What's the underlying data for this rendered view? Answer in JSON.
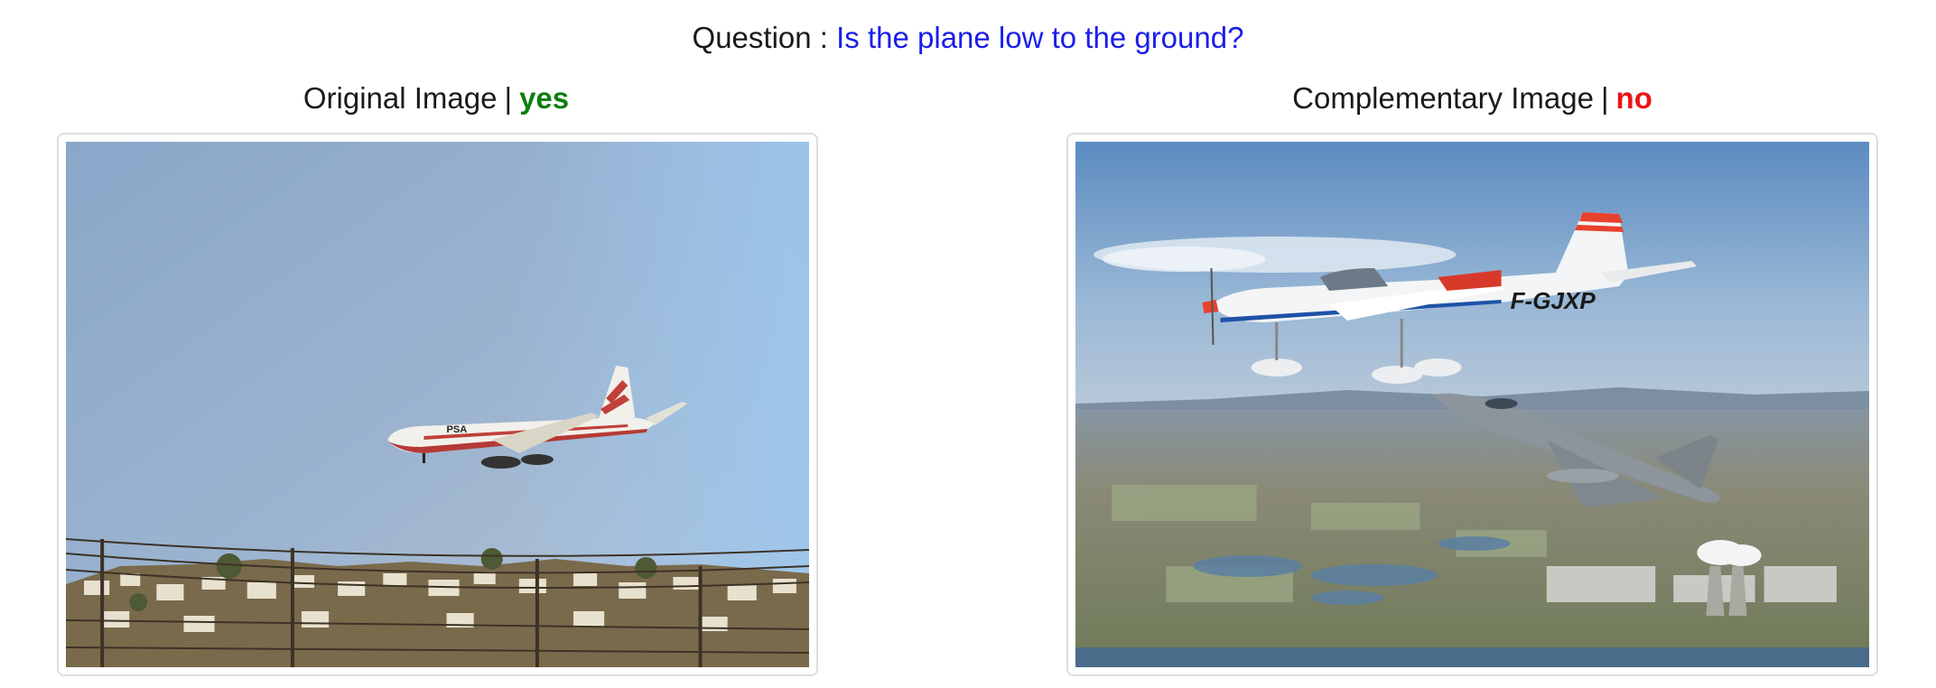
{
  "question": {
    "prefix": "Question :",
    "text": "Is the plane low to the ground?"
  },
  "original": {
    "title": "Original Image",
    "separator": "|",
    "answer": "yes",
    "answer_color": "#0e7d0e",
    "plane_livery_text": "PSA"
  },
  "complementary": {
    "title": "Complementary Image",
    "separator": "|",
    "answer": "no",
    "answer_color": "#e81616",
    "registration_text": "F-GJXP"
  }
}
